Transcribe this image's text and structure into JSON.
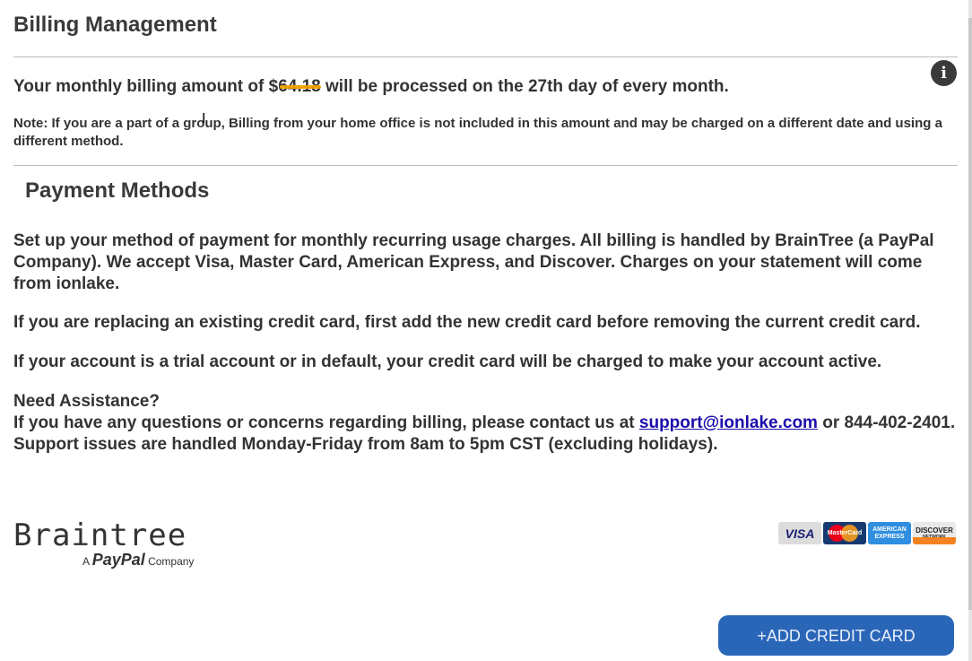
{
  "header": {
    "title": "Billing Management"
  },
  "billing": {
    "prefix": "Your monthly billing amount of ",
    "amount": "$64.18",
    "suffix": " will be processed on the 27th day of every month.",
    "note": "Note: If you are a part of a group, Billing from your home office is not included in this amount and may be charged on a different date and using a different method."
  },
  "payment": {
    "title": "Payment Methods",
    "para1": "Set up your method of payment for monthly recurring usage charges. All billing is handled by BrainTree (a PayPal Company). We accept Visa, Master Card, American Express, and Discover. Charges on your statement will come from ionlake.",
    "para2": "If you are replacing an existing credit card, first add the new credit card before removing the current credit card.",
    "para3": "If your account is a trial account or in default, your credit card will be charged to make your account active.",
    "assist_heading": "Need Assistance?",
    "assist_prefix": "If you have any questions or concerns regarding billing, please contact us at ",
    "support_email": "support@ionlake.com",
    "assist_phone": " or 844-402-2401.",
    "assist_hours": "Support issues are handled Monday-Friday from 8am to 5pm CST (excluding holidays)."
  },
  "braintree": {
    "wordmark": "Braintree",
    "sub_a": "A",
    "sub_paypal": "PayPal",
    "sub_company": "Company"
  },
  "cards": {
    "visa": "VISA",
    "mastercard": "MasterCard",
    "amex": "AMERICAN EXPRESS",
    "discover": "DISCOVER",
    "discover_sub": "NETWORK"
  },
  "actions": {
    "add_card": "+ADD CREDIT CARD"
  },
  "icons": {
    "info": "info-icon"
  },
  "colors": {
    "button": "#2a66b8",
    "highlight": "#f0a000"
  }
}
